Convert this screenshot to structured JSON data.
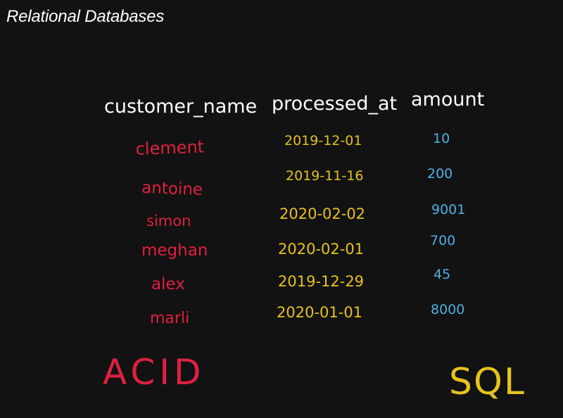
{
  "slide": {
    "title": "Relational Databases"
  },
  "table": {
    "headers": [
      "customer_name",
      "processed_at",
      "amount"
    ],
    "rows": [
      {
        "customer_name": "clement",
        "processed_at": "2019-12-01",
        "amount": "10"
      },
      {
        "customer_name": "antoine",
        "processed_at": "2019-11-16",
        "amount": "200"
      },
      {
        "customer_name": "simon",
        "processed_at": "2020-02-02",
        "amount": "9001"
      },
      {
        "customer_name": "meghan",
        "processed_at": "2020-02-01",
        "amount": "700"
      },
      {
        "customer_name": "alex",
        "processed_at": "2019-12-29",
        "amount": "45"
      },
      {
        "customer_name": "marli",
        "processed_at": "2020-01-01",
        "amount": "8000"
      }
    ]
  },
  "annotations": {
    "left": "ACID",
    "right": "SQL"
  },
  "colors": {
    "background": "#121212",
    "header": "#ffffff",
    "name": "#e0203f",
    "date": "#e6c21f",
    "amount": "#4fb0e6"
  }
}
